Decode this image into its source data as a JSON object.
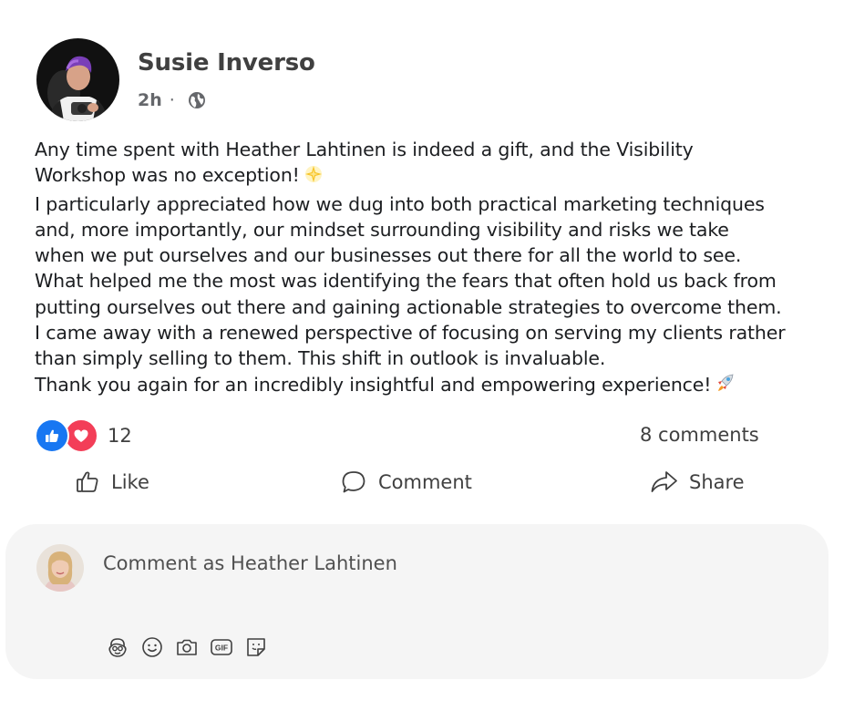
{
  "post": {
    "author": "Susie Inverso",
    "time": "2h",
    "separator": "·",
    "privacy_icon": "globe-icon",
    "body_lines": [
      "Any time spent with Heather Lahtinen is indeed a gift, and the Visibility",
      "Workshop was no exception!",
      "I particularly appreciated how we dug into both practical marketing techniques",
      "and, more importantly, our mindset surrounding visibility and risks we take",
      "when we put ourselves and our businesses out there for all the world to see.",
      "What helped me the most was identifying the fears that often hold us back from",
      "putting ourselves out there and gaining actionable strategies to overcome them.",
      "I came away with a renewed perspective of focusing on serving my clients rather",
      "than simply selling to them. This shift in outlook is invaluable.",
      "Thank you again for an incredibly insightful and empowering experience!"
    ],
    "emojis": [
      "glowing-star",
      "rocket"
    ]
  },
  "reactions": {
    "types": [
      "like",
      "love"
    ],
    "count": "12",
    "comments_label": "8 comments"
  },
  "actions": {
    "like": "Like",
    "comment": "Comment",
    "share": "Share"
  },
  "composer": {
    "placeholder": "Comment as Heather Lahtinen",
    "tools": [
      "avatar-sticker-icon",
      "emoji-icon",
      "camera-icon",
      "gif-icon",
      "sticker-icon"
    ]
  },
  "colors": {
    "like_blue": "#1877f2",
    "love_red": "#f33e58",
    "composer_bg": "#f5f5f5",
    "secondary_text": "#65676b"
  }
}
